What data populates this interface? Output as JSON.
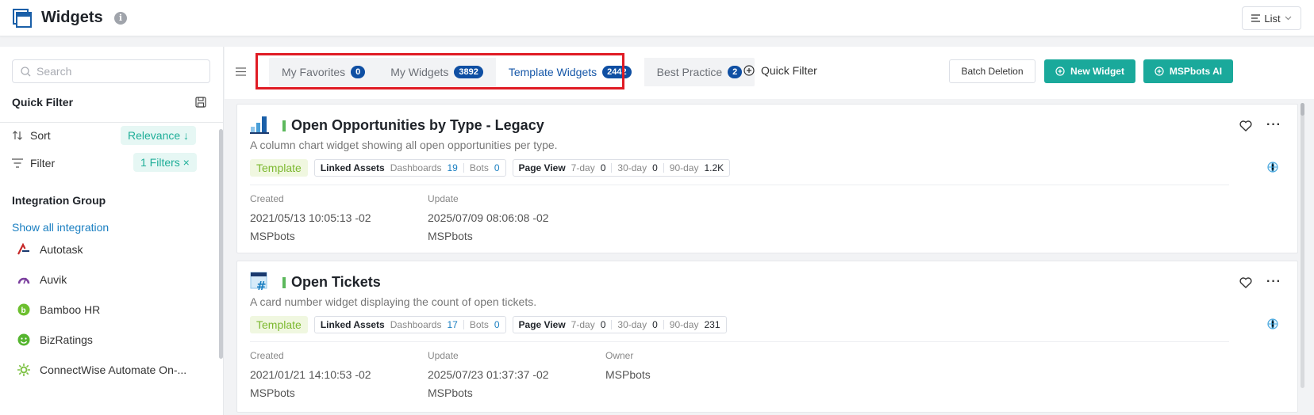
{
  "header": {
    "title": "Widgets",
    "info_symbol": "i",
    "view_label": "List"
  },
  "sidebar": {
    "search_placeholder": "Search",
    "quick_filter_title": "Quick Filter",
    "sort_label": "Sort",
    "sort_value": "Relevance ↓",
    "filter_label": "Filter",
    "filter_value": "1 Filters ×",
    "integration_group_title": "Integration Group",
    "show_all_label": "Show all integration",
    "integrations": [
      {
        "name": "Autotask",
        "icon": "autotask-icon",
        "color": "#c62828"
      },
      {
        "name": "Auvik",
        "icon": "auvik-icon",
        "color": "#7b3f9e"
      },
      {
        "name": "Bamboo HR",
        "icon": "bamboohr-icon",
        "color": "#6cbf2e"
      },
      {
        "name": "BizRatings",
        "icon": "bizratings-icon",
        "color": "#55b52f"
      },
      {
        "name": "ConnectWise Automate On-...",
        "icon": "connectwise-icon",
        "color": "#7cc142"
      }
    ]
  },
  "toolbar": {
    "tabs": [
      {
        "label": "My Favorites",
        "count": "0"
      },
      {
        "label": "My Widgets",
        "count": "3892"
      },
      {
        "label": "Template Widgets",
        "count": "2442"
      },
      {
        "label": "Best Practice",
        "count": "2"
      }
    ],
    "active_tab": "Template Widgets",
    "quick_filter_label": "Quick Filter",
    "batch_deletion_label": "Batch Deletion",
    "new_widget_label": "New Widget",
    "ai_label": "MSPbots AI"
  },
  "cards": [
    {
      "title": "Open Opportunities by Type - Legacy",
      "description": "A column chart widget showing all open opportunities per type.",
      "tag": "Template",
      "linked_assets_label": "Linked Assets",
      "dashboards_label": "Dashboards",
      "dashboards_count": "19",
      "bots_label": "Bots",
      "bots_count": "0",
      "page_view_label": "Page View",
      "views": [
        {
          "label": "7-day",
          "value": "0"
        },
        {
          "label": "30-day",
          "value": "0"
        },
        {
          "label": "90-day",
          "value": "1.2K"
        }
      ],
      "created_label": "Created",
      "created_date": "2021/05/13 10:05:13 -02",
      "created_by": "MSPbots",
      "update_label": "Update",
      "update_date": "2025/07/09 08:06:08 -02",
      "update_by": "MSPbots"
    },
    {
      "title": "Open Tickets",
      "description": "A card number widget displaying the count of open tickets.",
      "tag": "Template",
      "linked_assets_label": "Linked Assets",
      "dashboards_label": "Dashboards",
      "dashboards_count": "17",
      "bots_label": "Bots",
      "bots_count": "0",
      "page_view_label": "Page View",
      "views": [
        {
          "label": "7-day",
          "value": "0"
        },
        {
          "label": "30-day",
          "value": "0"
        },
        {
          "label": "90-day",
          "value": "231"
        }
      ],
      "created_label": "Created",
      "created_date": "2021/01/21 14:10:53 -02",
      "created_by": "MSPbots",
      "update_label": "Update",
      "update_date": "2025/07/23 01:37:37 -02",
      "update_by": "MSPbots",
      "owner_label": "Owner",
      "owner_name": "MSPbots"
    }
  ],
  "colors": {
    "accent": "#1aa99b",
    "tab_active": "#1657a8",
    "badge": "#0f4fa3",
    "highlight": "#e01b24",
    "link": "#1a7fc1"
  }
}
